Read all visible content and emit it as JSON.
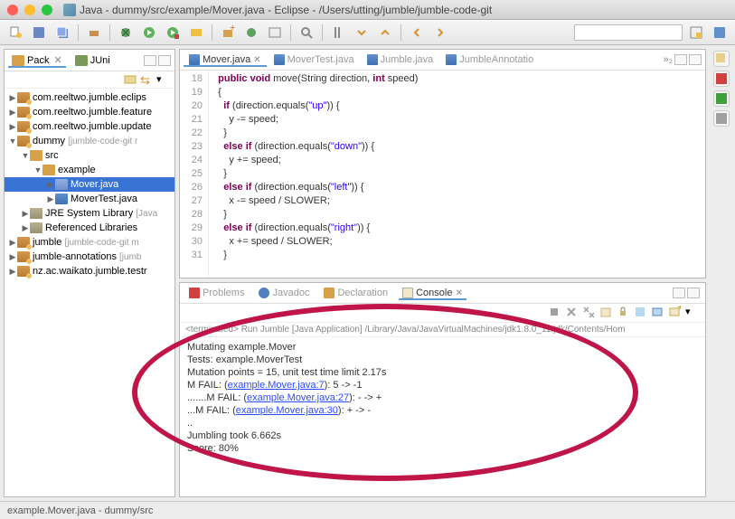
{
  "title": "Java - dummy/src/example/Mover.java - Eclipse - /Users/utting/jumble/jumble-code-git",
  "views": {
    "pack": "Pack",
    "junit": "JUni"
  },
  "tree": {
    "p0": "com.reeltwo.jumble.eclips",
    "p1": "com.reeltwo.jumble.feature",
    "p2": "com.reeltwo.jumble.update",
    "dummy": "dummy",
    "dummy_dec": "[jumble-code-git r",
    "src": "src",
    "example": "example",
    "mover": "Mover.java",
    "movertest": "MoverTest.java",
    "jre": "JRE System Library",
    "jre_dec": "[Java",
    "ref": "Referenced Libraries",
    "jumble": "jumble",
    "jumble_dec": "[jumble-code-git m",
    "jann": "jumble-annotations",
    "jann_dec": "[jumb",
    "nz": "nz.ac.waikato.jumble.testr"
  },
  "editor_tabs": {
    "mover": "Mover.java",
    "movertest": "MoverTest.java",
    "jumble": "Jumble.java",
    "jann": "JumbleAnnotatio",
    "more": "»₂"
  },
  "code": {
    "lines": [
      "18",
      "19",
      "20",
      "21",
      "22",
      "23",
      "24",
      "25",
      "26",
      "27",
      "28",
      "29",
      "30",
      "31"
    ],
    "l18a": "public",
    "l18b": " void",
    "l18c": " move(String direction, ",
    "l18d": "int",
    "l18e": " speed)",
    "l19": "{",
    "l20a": "if",
    "l20b": " (direction.equals(",
    "l20c": "\"up\"",
    "l20d": ")) {",
    "l21": "y -= speed;",
    "l22": "}",
    "l23a": "else",
    "l23b": " if",
    "l23c": " (direction.equals(",
    "l23d": "\"down\"",
    "l23e": ")) {",
    "l24": "y += speed;",
    "l25": "}",
    "l26a": "else",
    "l26b": " if",
    "l26c": " (direction.equals(",
    "l26d": "\"left\"",
    "l26e": ")) {",
    "l27": "x -= speed / SLOWER;",
    "l28": "}",
    "l29a": "else",
    "l29b": " if",
    "l29c": " (direction.equals(",
    "l29d": "\"right\"",
    "l29e": ")) {",
    "l30": "x += speed / SLOWER;",
    "l31": "}"
  },
  "bottom_tabs": {
    "problems": "Problems",
    "javadoc": "Javadoc",
    "decl": "Declaration",
    "console": "Console"
  },
  "term": "<terminated> Run Jumble [Java Application] /Library/Java/JavaVirtualMachines/jdk1.8.0_11.jdk/Contents/Hom",
  "console": {
    "l1": "Mutating example.Mover",
    "l2": "Tests: example.MoverTest",
    "l3": "Mutation points = 15, unit test time limit 2.17s",
    "l4a": "M FAIL: (",
    "l4b": "example.Mover.java:7",
    "l4c": "): 5 -> -1",
    "l5a": ".......M FAIL: (",
    "l5b": "example.Mover.java:27",
    "l5c": "): - -> +",
    "l6a": "...M FAIL: (",
    "l6b": "example.Mover.java:30",
    "l6c": "): + -> -",
    "l7": "..",
    "l8": "Jumbling took 6.662s",
    "l9": "Score: 80%"
  },
  "status": "example.Mover.java - dummy/src"
}
